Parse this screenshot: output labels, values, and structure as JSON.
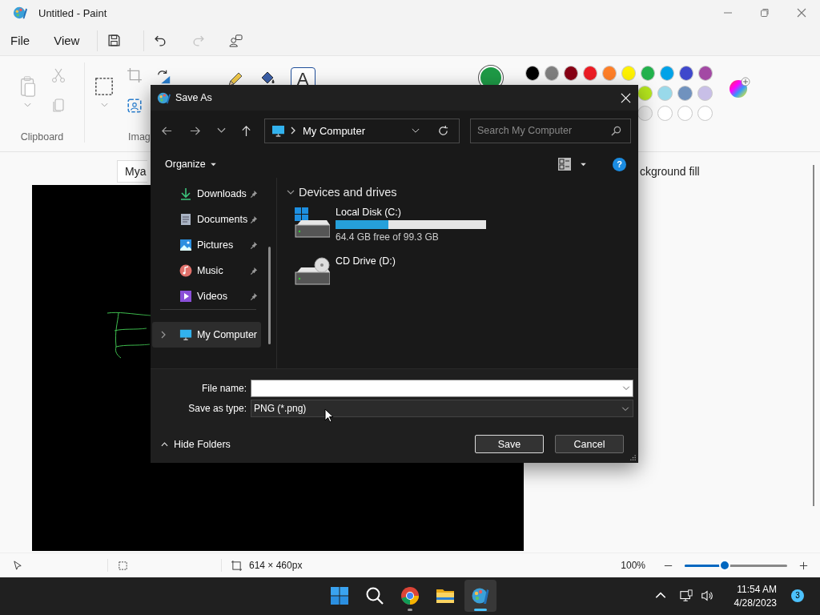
{
  "paint": {
    "title": "Untitled - Paint",
    "menu": [
      {
        "label": "File"
      },
      {
        "label": "View"
      }
    ],
    "undo": {
      "disabled": false
    },
    "redo": {
      "disabled": true
    },
    "ribbon": {
      "groups": [
        {
          "label": "Clipboard"
        },
        {
          "label": "Imag"
        }
      ],
      "text_tool": {
        "glyph": "A",
        "selected": true
      }
    },
    "palette": {
      "current": {
        "color": "#1e9a46"
      },
      "rows": [
        [
          {
            "color": "#000000"
          },
          {
            "color": "#7f7f7f"
          },
          {
            "color": "#880015"
          },
          {
            "color": "#ed1c24"
          },
          {
            "color": "#ff7f27"
          },
          {
            "color": "#fff200"
          },
          {
            "color": "#22b14c"
          },
          {
            "color": "#00a2e8"
          },
          {
            "color": "#3f48cc"
          },
          {
            "color": "#a349a4"
          }
        ],
        [
          {
            "color": "#b5e61d"
          },
          {
            "color": "#99d9ea"
          },
          {
            "color": "#7092be"
          },
          {
            "color": "#c8bfe7"
          }
        ],
        [
          {
            "color": "#eeeeee"
          },
          {
            "color": "#ffffff"
          },
          {
            "color": "#ffffff"
          },
          {
            "color": "#ffffff"
          }
        ]
      ]
    },
    "text_toolbar": {
      "font_field": "Mya"
    },
    "side_panel": {
      "text": "ckground fill"
    },
    "status_bar": {
      "dimensions": "614 × 460px",
      "zoom": "100%",
      "zoom_slider": {
        "level": 0.39
      }
    }
  },
  "taskbar": {
    "apps": [
      {
        "kind": "start",
        "running": false,
        "selected": false
      },
      {
        "kind": "search",
        "running": false,
        "selected": false
      },
      {
        "kind": "browser",
        "running": true,
        "selected": false
      },
      {
        "kind": "folder",
        "running": false,
        "selected": false
      },
      {
        "kind": "paint",
        "running": true,
        "selected": true
      }
    ],
    "time": "11:54 AM",
    "date": "4/28/2023",
    "notifications": "3"
  },
  "dialog": {
    "title": "Save As",
    "address": "My Computer",
    "search": {
      "placeholder": "Search My Computer"
    },
    "organize": "Organize",
    "help": "?",
    "nav": [
      {
        "label": "Downloads",
        "kind": "download",
        "pinned": true,
        "selected": false
      },
      {
        "label": "Documents",
        "kind": "document",
        "pinned": true,
        "selected": false
      },
      {
        "label": "Pictures",
        "kind": "picture",
        "pinned": true,
        "selected": false
      },
      {
        "label": "Music",
        "kind": "music",
        "pinned": true,
        "selected": false
      },
      {
        "label": "Videos",
        "kind": "video",
        "pinned": true,
        "selected": false
      },
      {
        "label": "My Computer",
        "kind": "computer",
        "pinned": false,
        "selected": true
      }
    ],
    "group": {
      "label": "Devices and drives",
      "expanded": true
    },
    "drives": [
      {
        "kind": "disk",
        "name": "Local Disk (C:)",
        "level": 0.35,
        "info": "64.4 GB free of 99.3 GB"
      },
      {
        "kind": "cd",
        "name": "CD Drive (D:)"
      }
    ],
    "file_name": {
      "label": "File name:"
    },
    "save_type": {
      "label": "Save as type:",
      "value": "PNG (*.png)"
    },
    "hide_folders": "Hide Folders",
    "buttons": [
      {
        "label": "Save",
        "default": true
      },
      {
        "label": "Cancel",
        "default": false
      }
    ]
  }
}
